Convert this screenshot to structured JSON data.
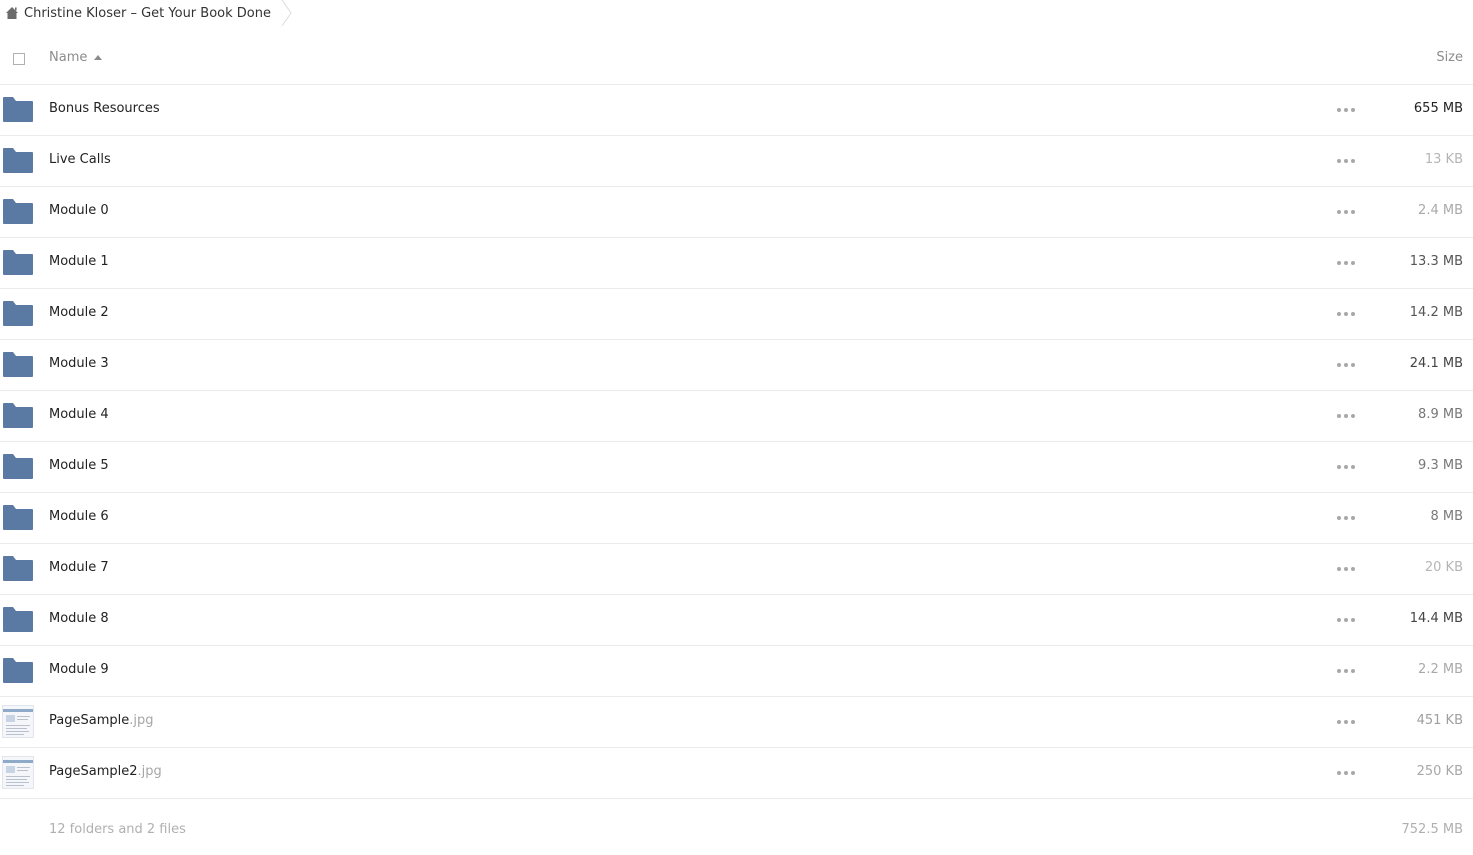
{
  "breadcrumb": {
    "items": [
      {
        "label": "Christine Kloser – Get Your Book Done",
        "icon": "home-icon"
      }
    ]
  },
  "table": {
    "headers": {
      "name": "Name",
      "size": "Size",
      "sort": "ascending"
    },
    "rows": [
      {
        "name": "Bonus Resources",
        "ext": "",
        "type": "folder",
        "size": "655 MB",
        "size_color": "#222222"
      },
      {
        "name": "Live Calls",
        "ext": "",
        "type": "folder",
        "size": "13 KB",
        "size_color": "#b5b5b5"
      },
      {
        "name": "Module 0",
        "ext": "",
        "type": "folder",
        "size": "2.4 MB",
        "size_color": "#a9a9a9"
      },
      {
        "name": "Module 1",
        "ext": "",
        "type": "folder",
        "size": "13.3 MB",
        "size_color": "#555555"
      },
      {
        "name": "Module 2",
        "ext": "",
        "type": "folder",
        "size": "14.2 MB",
        "size_color": "#555555"
      },
      {
        "name": "Module 3",
        "ext": "",
        "type": "folder",
        "size": "24.1 MB",
        "size_color": "#444444"
      },
      {
        "name": "Module 4",
        "ext": "",
        "type": "folder",
        "size": "8.9 MB",
        "size_color": "#777777"
      },
      {
        "name": "Module 5",
        "ext": "",
        "type": "folder",
        "size": "9.3 MB",
        "size_color": "#777777"
      },
      {
        "name": "Module 6",
        "ext": "",
        "type": "folder",
        "size": "8 MB",
        "size_color": "#7a7a7a"
      },
      {
        "name": "Module 7",
        "ext": "",
        "type": "folder",
        "size": "20 KB",
        "size_color": "#b5b5b5"
      },
      {
        "name": "Module 8",
        "ext": "",
        "type": "folder",
        "size": "14.4 MB",
        "size_color": "#444444"
      },
      {
        "name": "Module 9",
        "ext": "",
        "type": "folder",
        "size": "2.2 MB",
        "size_color": "#a9a9a9"
      },
      {
        "name": "PageSample",
        "ext": ".jpg",
        "type": "image",
        "size": "451 KB",
        "size_color": "#a0a0a0"
      },
      {
        "name": "PageSample2",
        "ext": ".jpg",
        "type": "image",
        "size": "250 KB",
        "size_color": "#a8a8a8"
      }
    ],
    "summary": {
      "text": "12 folders and 2 files",
      "size": "752.5 MB"
    }
  },
  "colors": {
    "folder": "#5b7aa3",
    "border": "#ebebeb"
  }
}
